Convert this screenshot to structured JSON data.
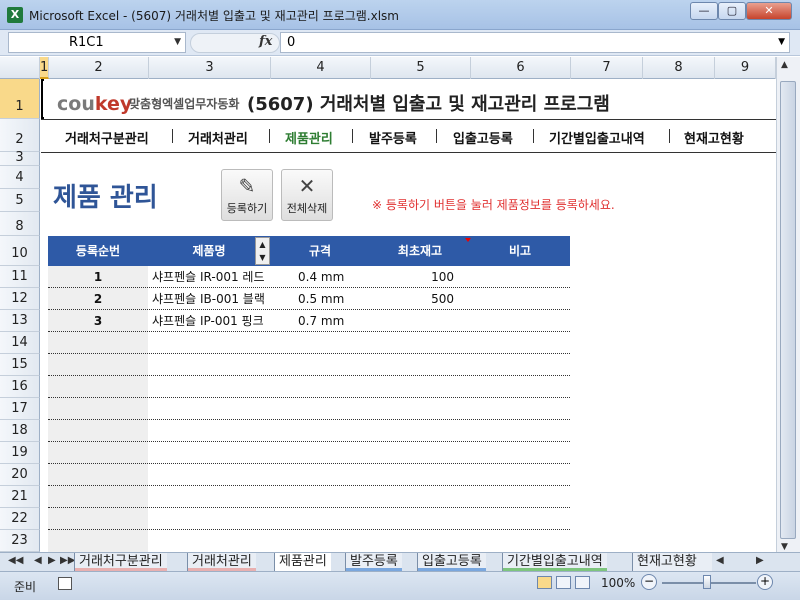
{
  "window": {
    "title": "Microsoft Excel - (5607) 거래처별 입출고 및 재고관리 프로그램.xlsm",
    "app_icon": "X"
  },
  "formula_bar": {
    "name_box": "R1C1",
    "fx_label": "fx",
    "value": "0"
  },
  "columns": [
    "1",
    "2",
    "3",
    "4",
    "5",
    "6",
    "7",
    "8",
    "9"
  ],
  "rows": [
    "1",
    "2",
    "3",
    "4",
    "5",
    "8",
    "10",
    "11",
    "12",
    "13",
    "14",
    "15",
    "16",
    "17",
    "18",
    "19",
    "20",
    "21",
    "22",
    "23"
  ],
  "header": {
    "brand_co": "cou",
    "brand_key": "key",
    "tagline": "맞춤형엑셀업무자동화",
    "program_title": "(5607) 거래처별 입출고 및 재고관리 프로그램"
  },
  "nav": {
    "items": [
      "거래처구분관리",
      "거래처관리",
      "제품관리",
      "발주등록",
      "입출고등록",
      "기간별입출고내역",
      "현재고현황"
    ],
    "active_index": 2
  },
  "page": {
    "title": "제품 관리",
    "register_label": "등록하기",
    "delete_all_label": "전체삭제",
    "notice": "※ 등록하기 버튼을 눌러 제품정보를 등록하세요."
  },
  "table": {
    "headers": [
      "등록순번",
      "제품명",
      "규격",
      "최초재고",
      "비고"
    ],
    "rows": [
      {
        "seq": "1",
        "name": "샤프펜슬 IR-001 레드",
        "spec": "0.4 mm",
        "stock": "100",
        "note": ""
      },
      {
        "seq": "2",
        "name": "샤프펜슬 IB-001 블랙",
        "spec": "0.5 mm",
        "stock": "500",
        "note": ""
      },
      {
        "seq": "3",
        "name": "샤프펜슬 IP-001 핑크",
        "spec": "0.7 mm",
        "stock": "",
        "note": ""
      }
    ]
  },
  "sheet_tabs": [
    "거래처구분관리",
    "거래처관리",
    "제품관리",
    "발주등록",
    "입출고등록",
    "기간별입출고내역",
    "현재고현황"
  ],
  "sheet_tab_active": 2,
  "status": {
    "mode": "준비",
    "zoom": "100%"
  },
  "colors": {
    "accent": "#2e5aa7",
    "title_blue": "#2f5597",
    "nav_active": "#2e7d32",
    "notice_red": "#e03030"
  }
}
